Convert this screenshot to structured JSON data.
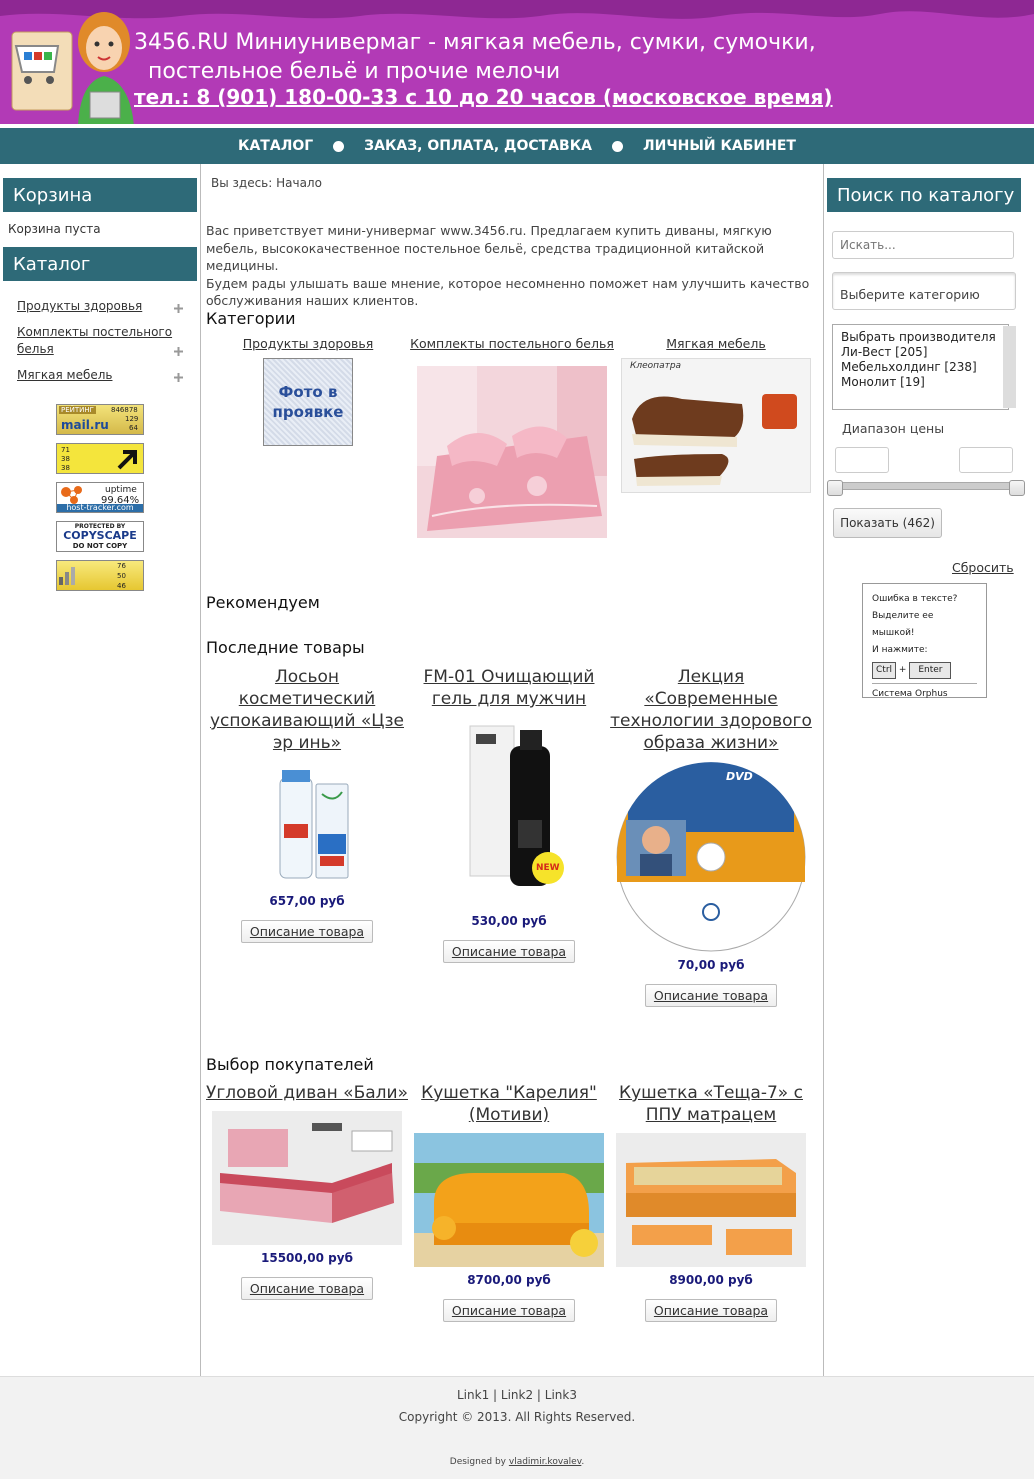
{
  "header": {
    "title_line1": "3456.RU Миниунивермаг - мягкая мебель, сумки, сумочки,",
    "title_line2": "постельное бельё и прочие мелочи",
    "phone": "тел.: 8 (901) 180-00-33 с 10 до 20 часов (московское время)",
    "bg_color": "#b23ab6"
  },
  "nav": {
    "items": [
      "КАТАЛОГ",
      "ЗАКАЗ, ОПЛАТА, ДОСТАВКА",
      "ЛИЧНЫЙ КАБИНЕТ"
    ],
    "bg_color": "#2e6a78"
  },
  "left": {
    "cart_title": "Корзина",
    "cart_empty": "Корзина пуста",
    "catalog_title": "Каталог",
    "categories": [
      "Продукты здоровья",
      "Комплекты постельного белья",
      "Мягкая мебель"
    ],
    "counters": {
      "mailru": {
        "label": "РЕЙТИНГ",
        "brand": "mail.ru",
        "n1": "846878",
        "n2": "129",
        "n3": "64"
      },
      "li": {
        "n1": "71",
        "n2": "38",
        "n3": "38"
      },
      "hosttracker": {
        "label": "uptime",
        "value": "99.64%",
        "brand": "host-tracker.com"
      },
      "copyscape": {
        "line1": "PROTECTED BY",
        "line2": "COPYSCAPE",
        "line3": "DO NOT COPY"
      },
      "stats": {
        "n1": "76",
        "n2": "50",
        "n3": "46"
      }
    }
  },
  "main": {
    "breadcrumb": "Вы здесь: Начало",
    "intro_1": "Вас приветствует мини-универмаг www.3456.ru. Предлагаем купить диваны, мягкую мебель, высококачественное постельное бельё, средства традиционной китайской медицины.",
    "intro_2": "Будем рады улышать ваше мнение, которое несомненно поможет нам улучшить качество обслуживания наших клиентов.",
    "categories_heading": "Категории",
    "categories": [
      {
        "name": "Продукты здоровья",
        "photo_text": "Фото в проявке"
      },
      {
        "name": "Комплекты постельного белья"
      },
      {
        "name": "Мягкая мебель",
        "image_caption": "Клеопатра"
      }
    ],
    "recommend_heading": "Рекомендуем",
    "latest_heading": "Последние товары",
    "latest": [
      {
        "name": "Лосьон косметический успокаивающий «Цзе эр инь»",
        "price": "657,00 руб",
        "button": "Описание товара"
      },
      {
        "name": "FM-01 Очищающий гель для мужчин",
        "price": "530,00 руб",
        "button": "Описание товара",
        "badge": "NEW"
      },
      {
        "name": "Лекция «Современные технологии здорового образа жизни»",
        "price": "70,00 руб",
        "button": "Описание товара",
        "disc_label": "DVD"
      }
    ],
    "choice_heading": "Выбор покупателей",
    "choice": [
      {
        "name": "Угловой диван «Бали»",
        "price": "15500,00 руб",
        "button": "Описание товара"
      },
      {
        "name": "Кушетка \"Карелия\" (Мотиви)",
        "price": "8700,00 руб",
        "button": "Описание товара"
      },
      {
        "name": "Кушетка «Теща-7» с ППУ матрацем",
        "price": "8900,00 руб",
        "button": "Описание товара"
      }
    ]
  },
  "right": {
    "search_title": "Поиск по каталогу",
    "search_placeholder": "Искать...",
    "category_select": "Выберите категорию",
    "manufacturers": [
      "Выбрать производителя",
      "Ли-Вест [205]",
      "Мебельхолдинг [238]",
      "Монолит [19]"
    ],
    "price_range_label": "Диапазон цены",
    "show_button": "Показать (462)",
    "reset": "Сбросить",
    "orphus": {
      "line1": "Ошибка в тексте?",
      "line2": "Выделите ее мышкой!",
      "line3": "И нажмите:",
      "key1": "Ctrl",
      "plus": "+",
      "key2": "Enter",
      "footer": "Система Orphus"
    }
  },
  "footer": {
    "links": [
      "Link1",
      "Link2",
      "Link3"
    ],
    "copyright": "Copyright © 2013. All Rights Reserved.",
    "designed_by_prefix": "Designed by",
    "designer": "vladimir.kovalev"
  }
}
